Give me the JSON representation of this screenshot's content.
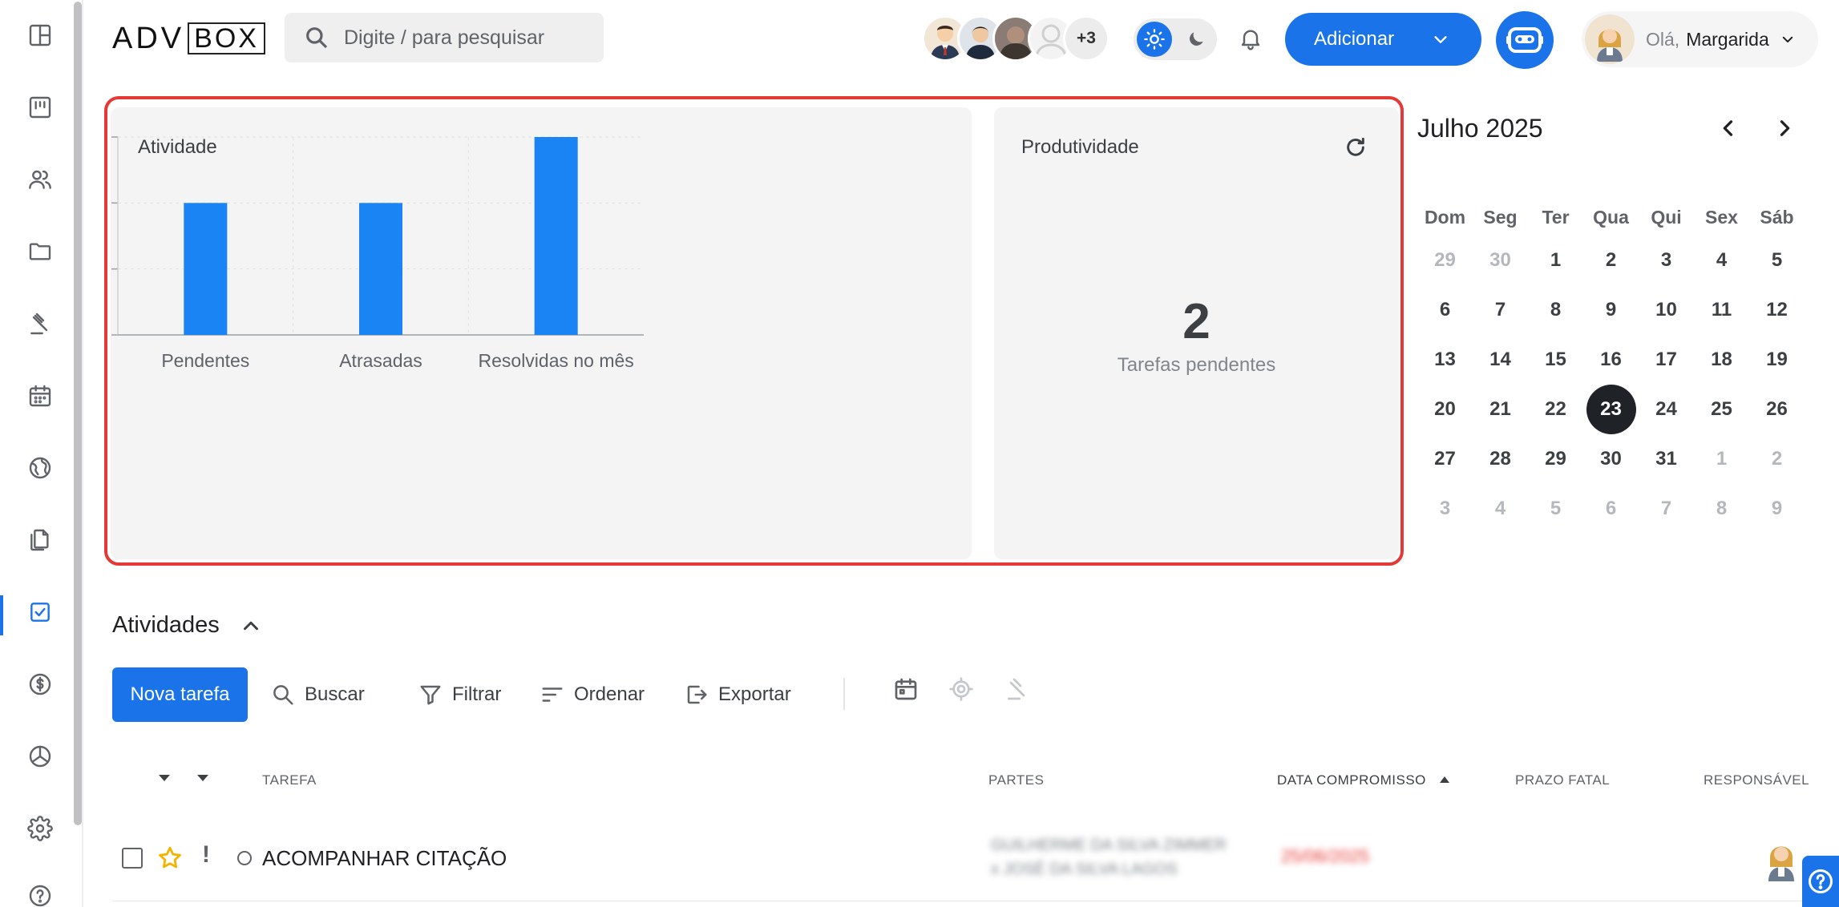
{
  "app": {
    "logo_adv": "ADV",
    "logo_box": "BOX"
  },
  "header": {
    "search_placeholder": "Digite / para pesquisar",
    "avatars_more": "+3",
    "add_button": "Adicionar",
    "greeting": "Olá,",
    "user_name": "Margarida"
  },
  "sidebar": {
    "items": [
      {
        "icon": "dashboard-icon"
      },
      {
        "icon": "kanban-icon"
      },
      {
        "icon": "contacts-icon"
      },
      {
        "icon": "folder-icon"
      },
      {
        "icon": "gavel-icon"
      },
      {
        "icon": "calendar-icon"
      },
      {
        "icon": "globe-icon"
      },
      {
        "icon": "documents-icon"
      },
      {
        "icon": "tasks-icon",
        "active": true
      },
      {
        "icon": "finance-icon"
      },
      {
        "icon": "reports-icon"
      },
      {
        "icon": "settings-icon"
      },
      {
        "icon": "help-icon"
      }
    ]
  },
  "activity_card": {
    "title": "Atividade"
  },
  "chart_data": {
    "type": "bar",
    "categories": [
      "Pendentes",
      "Atrasadas",
      "Resolvidas no mês"
    ],
    "values": [
      2,
      2,
      3
    ],
    "ylim": [
      0,
      3
    ],
    "yticks": [
      "0",
      "1",
      "2",
      "3"
    ],
    "color": "#1a84f5",
    "grid": true,
    "title": "",
    "xlabel": "",
    "ylabel": ""
  },
  "productivity_card": {
    "title": "Produtividade",
    "value": "2",
    "label": "Tarefas pendentes"
  },
  "calendar": {
    "title": "Julho 2025",
    "weekdays": [
      "Dom",
      "Seg",
      "Ter",
      "Qua",
      "Qui",
      "Sex",
      "Sáb"
    ],
    "weeks": [
      [
        {
          "d": "29",
          "m": true
        },
        {
          "d": "30",
          "m": true
        },
        {
          "d": "1"
        },
        {
          "d": "2"
        },
        {
          "d": "3"
        },
        {
          "d": "4"
        },
        {
          "d": "5"
        }
      ],
      [
        {
          "d": "6"
        },
        {
          "d": "7"
        },
        {
          "d": "8"
        },
        {
          "d": "9"
        },
        {
          "d": "10"
        },
        {
          "d": "11"
        },
        {
          "d": "12"
        }
      ],
      [
        {
          "d": "13"
        },
        {
          "d": "14"
        },
        {
          "d": "15"
        },
        {
          "d": "16"
        },
        {
          "d": "17"
        },
        {
          "d": "18"
        },
        {
          "d": "19"
        }
      ],
      [
        {
          "d": "20"
        },
        {
          "d": "21"
        },
        {
          "d": "22"
        },
        {
          "d": "23",
          "today": true
        },
        {
          "d": "24"
        },
        {
          "d": "25"
        },
        {
          "d": "26"
        }
      ],
      [
        {
          "d": "27"
        },
        {
          "d": "28"
        },
        {
          "d": "29"
        },
        {
          "d": "30"
        },
        {
          "d": "31"
        },
        {
          "d": "1",
          "m": true
        },
        {
          "d": "2",
          "m": true
        }
      ],
      [
        {
          "d": "3",
          "m": true
        },
        {
          "d": "4",
          "m": true
        },
        {
          "d": "5",
          "m": true
        },
        {
          "d": "6",
          "m": true
        },
        {
          "d": "7",
          "m": true
        },
        {
          "d": "8",
          "m": true
        },
        {
          "d": "9",
          "m": true
        }
      ]
    ]
  },
  "activities": {
    "title": "Atividades",
    "new_task": "Nova tarefa",
    "search": "Buscar",
    "filter": "Filtrar",
    "sort": "Ordenar",
    "export": "Exportar",
    "columns": {
      "task": "TAREFA",
      "parties": "PARTES",
      "date": "DATA COMPROMISSO",
      "deadline": "PRAZO FATAL",
      "responsible": "RESPONSÁVEL"
    },
    "rows": [
      {
        "task": "ACOMPANHAR CITAÇÃO",
        "parties_line1": "GUILHERME DA SILVA ZIMMER",
        "parties_line2": "x JOSÉ DA SILVA LAGOS",
        "date": "25/06/2025"
      }
    ]
  },
  "colors": {
    "accent": "#1a73e8",
    "highlight": "#e53935"
  }
}
